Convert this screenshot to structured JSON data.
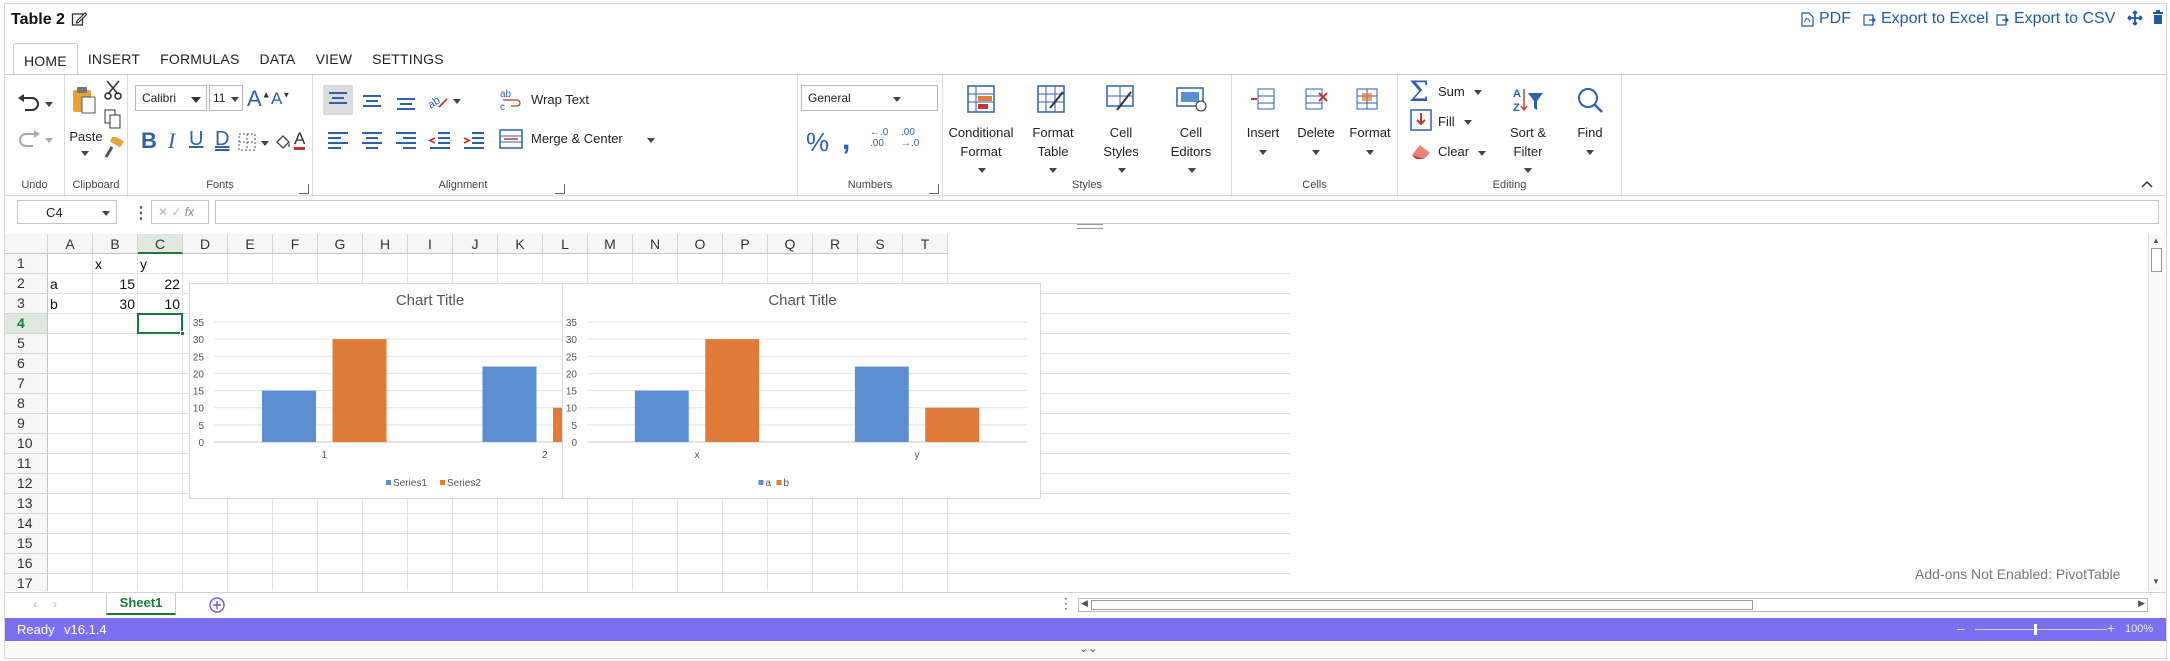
{
  "header": {
    "title": "Table 2",
    "pdf": "PDF",
    "export_excel": "Export to Excel",
    "export_csv": "Export to CSV"
  },
  "tabs": [
    "HOME",
    "INSERT",
    "FORMULAS",
    "DATA",
    "VIEW",
    "SETTINGS"
  ],
  "ribbon": {
    "undo": {
      "caption": "Undo"
    },
    "clipboard": {
      "paste": "Paste",
      "caption": "Clipboard"
    },
    "fonts": {
      "font_name": "Calibri",
      "font_size": "11",
      "caption": "Fonts"
    },
    "alignment": {
      "wrap": "Wrap Text",
      "merge": "Merge & Center",
      "caption": "Alignment"
    },
    "numbers": {
      "format": "General",
      "caption": "Numbers"
    },
    "styles": {
      "cond1": "Conditional",
      "cond2": "Format",
      "fmt1": "Format",
      "fmt2": "Table",
      "cell1": "Cell",
      "cell2": "Styles",
      "ed1": "Cell",
      "ed2": "Editors",
      "caption": "Styles"
    },
    "cells": {
      "insert": "Insert",
      "delete": "Delete",
      "format": "Format",
      "caption": "Cells"
    },
    "editing": {
      "sum": "Sum",
      "fill": "Fill",
      "clear": "Clear",
      "sort1": "Sort &",
      "sort2": "Filter",
      "find": "Find",
      "caption": "Editing"
    }
  },
  "formula_bar": {
    "cell_ref": "C4",
    "fx": "fx",
    "formula": ""
  },
  "grid": {
    "columns": [
      "A",
      "B",
      "C",
      "D",
      "E",
      "F",
      "G",
      "H",
      "I",
      "J",
      "K",
      "L",
      "M",
      "N",
      "O",
      "P",
      "Q",
      "R",
      "S",
      "T"
    ],
    "rows": [
      "1",
      "2",
      "3",
      "4",
      "5",
      "6",
      "7",
      "8",
      "9",
      "10",
      "11",
      "12",
      "13",
      "14",
      "15",
      "16",
      "17"
    ],
    "active_cell": "C4",
    "cells": {
      "B1": "x",
      "C1": "y",
      "A2": "a",
      "B2": "15",
      "C2": "22",
      "A3": "b",
      "B3": "30",
      "C3": "10"
    }
  },
  "chart_data": [
    {
      "type": "bar",
      "title": "Chart Title",
      "categories": [
        "1",
        "2"
      ],
      "series": [
        {
          "name": "Series1",
          "values": [
            15,
            22
          ],
          "color": "#5b8fd1"
        },
        {
          "name": "Series2",
          "values": [
            30,
            10
          ],
          "color": "#e07b39"
        }
      ],
      "ylim": [
        0,
        35
      ],
      "yticks": [
        0,
        5,
        10,
        15,
        20,
        25,
        30,
        35
      ],
      "grid": true,
      "legend": "bottom"
    },
    {
      "type": "bar",
      "title": "Chart Title",
      "categories": [
        "x",
        "y"
      ],
      "series": [
        {
          "name": "a",
          "values": [
            15,
            22
          ],
          "color": "#5b8fd1"
        },
        {
          "name": "b",
          "values": [
            30,
            10
          ],
          "color": "#e07b39"
        }
      ],
      "ylim": [
        0,
        35
      ],
      "yticks": [
        0,
        5,
        10,
        15,
        20,
        25,
        30,
        35
      ],
      "grid": true,
      "legend": "bottom"
    }
  ],
  "addons_note": "Add-ons Not Enabled: PivotTable",
  "sheet_tabs": [
    "Sheet1"
  ],
  "status": {
    "ready": "Ready",
    "version": "v16.1.4",
    "zoom": "100%"
  },
  "colors": {
    "accent": "#7b6ff2",
    "link": "#1e5aa8",
    "active_sheet": "#1a7a3a"
  }
}
